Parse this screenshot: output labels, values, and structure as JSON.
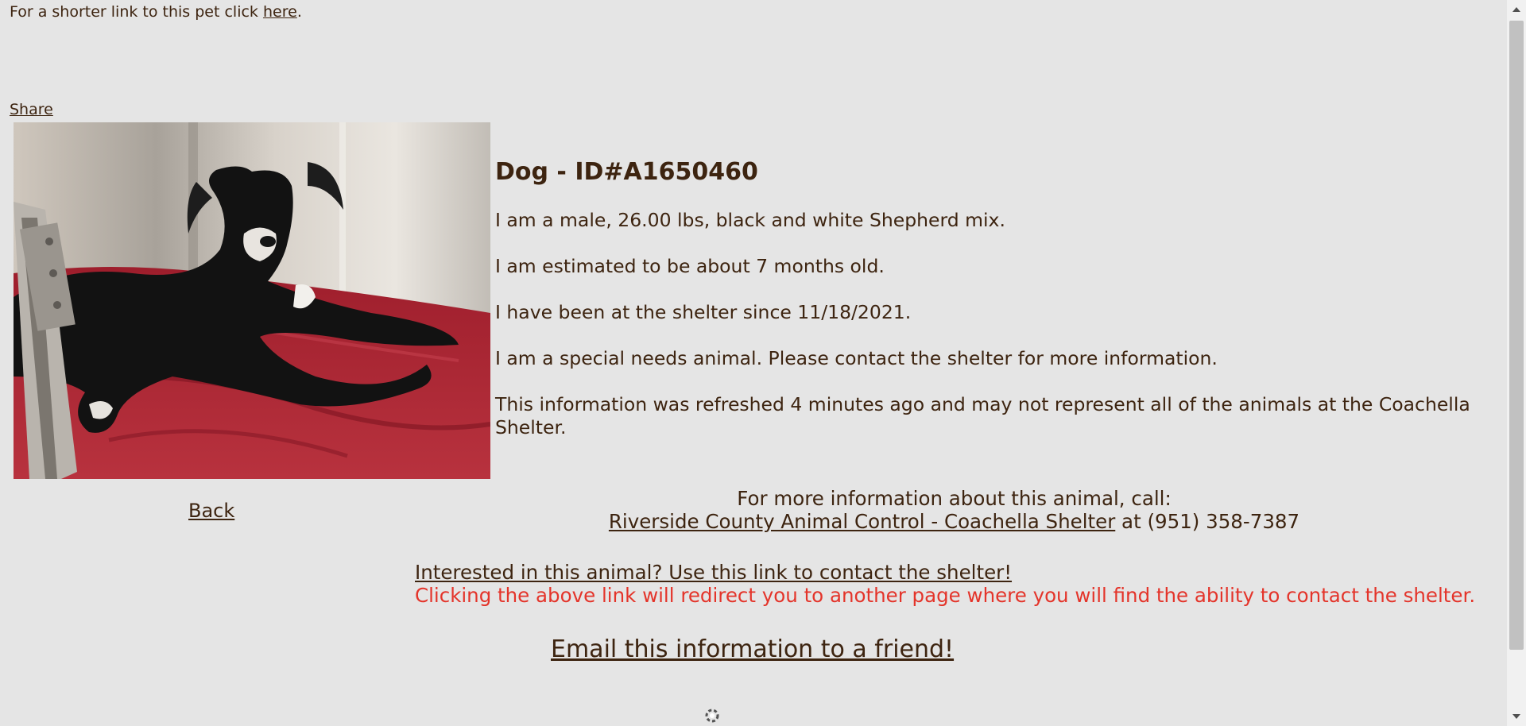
{
  "header": {
    "short_link_prefix": "For a shorter link to this pet click ",
    "short_link_label": "here",
    "short_link_suffix": "."
  },
  "share_label": "Share",
  "pet": {
    "photo_icon": "dog-photo",
    "title": "Dog - ID#A1650460",
    "description": "I am a male, 26.00 lbs, black and white Shepherd mix.",
    "age": "I am estimated to be about 7 months old.",
    "shelter_since": "I have been at the shelter since 11/18/2021.",
    "special_needs": "I am a special needs animal. Please contact the shelter for more information.",
    "refresh_note": "This information was refreshed 4 minutes ago and may not represent all of the animals at the Coachella Shelter."
  },
  "back_label": "Back",
  "contact": {
    "intro": "For more information about this animal, call:",
    "shelter_link": "Riverside County Animal Control - Coachella Shelter",
    "at_phone": " at (951) 358-7387"
  },
  "interest": {
    "link": "Interested in this animal? Use this link to contact the shelter!",
    "warning": "Clicking the above link will redirect you to another page where you will find the ability to contact the shelter."
  },
  "email_label": "Email this information to a friend!",
  "colors": {
    "background": "#e5e5e5",
    "text": "#3d2410",
    "warning": "#e4342a"
  },
  "icons": {
    "loading": "spinner-icon",
    "scroll_up": "chevron-up-icon",
    "scroll_down": "chevron-down-icon"
  }
}
